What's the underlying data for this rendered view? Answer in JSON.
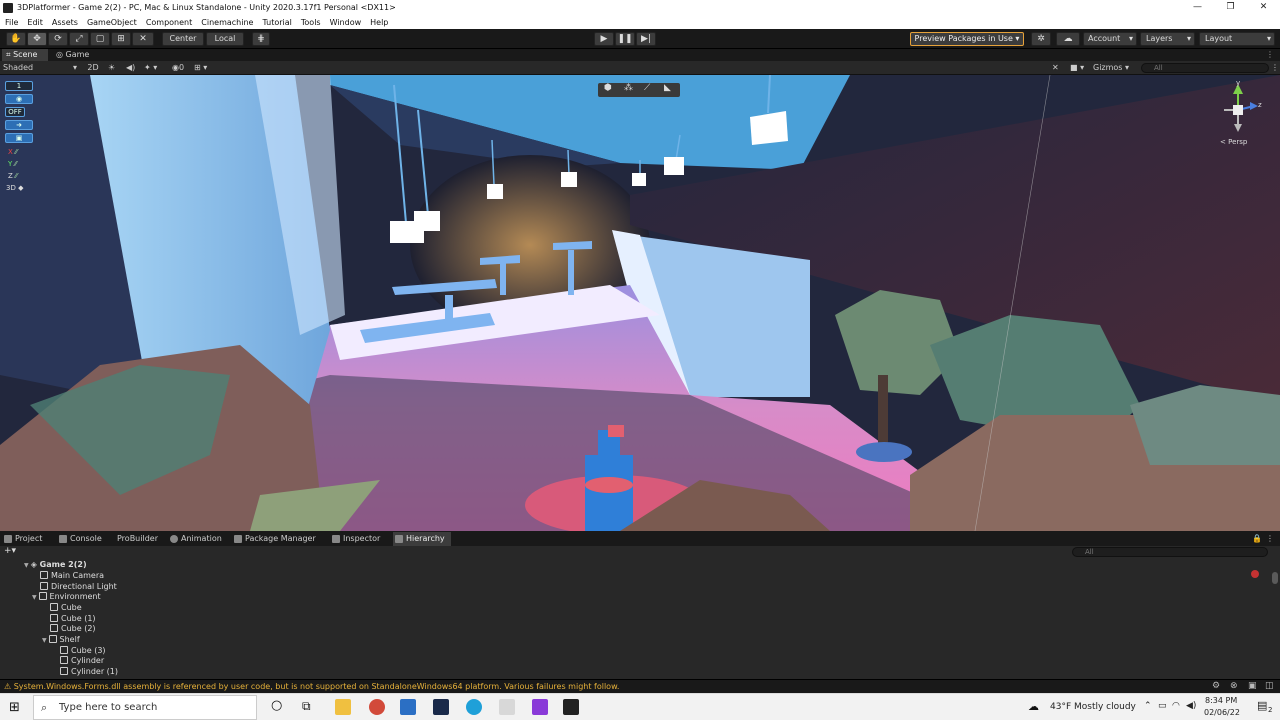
{
  "window": {
    "title": "3DPlatformer - Game 2(2) - PC, Mac & Linux Standalone - Unity 2020.3.17f1 Personal <DX11>",
    "controls": [
      "—",
      "❐",
      "✕"
    ]
  },
  "menu": [
    "File",
    "Edit",
    "Assets",
    "GameObject",
    "Component",
    "Cinemachine",
    "Tutorial",
    "Tools",
    "Window",
    "Help"
  ],
  "toolbar": {
    "center_label": "Center",
    "local_label": "Local",
    "preview_packages": "Preview Packages in Use",
    "account": "Account",
    "layers": "Layers",
    "layout": "Layout"
  },
  "scene_tabs": [
    "Scene",
    "Game"
  ],
  "scene_bar": {
    "shading": "Shaded",
    "mode_2d": "2D",
    "hidden_count": "0",
    "gizmos": "Gizmos",
    "search_placeholder": "All"
  },
  "viewport": {
    "overlay": {
      "number": "1",
      "off": "OFF",
      "x": "X",
      "y": "Y",
      "z": "Z",
      "mode_3d": "3D"
    },
    "gizmo": {
      "axis_y": "y",
      "axis_z": "z",
      "projection": "Persp"
    }
  },
  "bottom_tabs": [
    {
      "label": "Project",
      "icon": "folder-icon"
    },
    {
      "label": "Console",
      "icon": "console-icon"
    },
    {
      "label": "ProBuilder",
      "icon": ""
    },
    {
      "label": "Animation",
      "icon": "animation-icon"
    },
    {
      "label": "Package Manager",
      "icon": "package-icon"
    },
    {
      "label": "Inspector",
      "icon": "info-icon"
    },
    {
      "label": "Hierarchy",
      "icon": "list-icon"
    }
  ],
  "hierarchy": {
    "add_label": "+▾",
    "search_placeholder": "All",
    "items": [
      {
        "label": "Game 2(2)",
        "depth": 0,
        "expanded": true,
        "scene": true
      },
      {
        "label": "Main Camera",
        "depth": 1
      },
      {
        "label": "Directional Light",
        "depth": 1
      },
      {
        "label": "Environment",
        "depth": 1,
        "expanded": true
      },
      {
        "label": "Cube",
        "depth": 2
      },
      {
        "label": "Cube (1)",
        "depth": 2
      },
      {
        "label": "Cube (2)",
        "depth": 2
      },
      {
        "label": "Shelf",
        "depth": 2,
        "expanded": true
      },
      {
        "label": "Cube (3)",
        "depth": 3
      },
      {
        "label": "Cylinder",
        "depth": 3
      },
      {
        "label": "Cylinder (1)",
        "depth": 3
      }
    ]
  },
  "status": {
    "warning": "System.Windows.Forms.dll assembly is referenced by user code, but is not supported on StandaloneWindows64 platform. Various failures might follow."
  },
  "taskbar": {
    "search_placeholder": "Type here to search",
    "weather": "43°F  Mostly cloudy",
    "time": "8:34 PM",
    "date": "02/06/22",
    "notifications": "2"
  },
  "colors": {
    "accent_blue": "#2d6fb5",
    "warning": "#e6b13a",
    "preview_border": "#e6a23a"
  }
}
